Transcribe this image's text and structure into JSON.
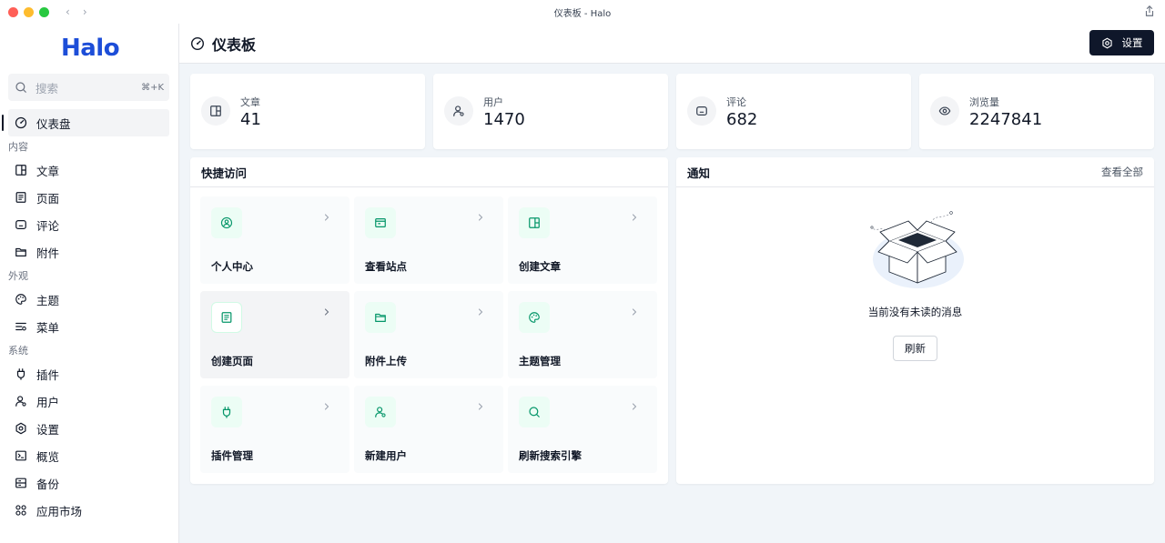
{
  "window": {
    "title": "仪表板 - Halo"
  },
  "app": {
    "logo": "Halo"
  },
  "search": {
    "placeholder": "搜索",
    "shortcut": "⌘+K"
  },
  "sidebar": {
    "dashboard": {
      "label": "仪表盘",
      "icon": "dashboard-icon"
    },
    "groups": [
      {
        "label": "内容",
        "items": [
          {
            "label": "文章",
            "icon": "post-icon"
          },
          {
            "label": "页面",
            "icon": "page-icon"
          },
          {
            "label": "评论",
            "icon": "comment-icon"
          },
          {
            "label": "附件",
            "icon": "folder-icon"
          }
        ]
      },
      {
        "label": "外观",
        "items": [
          {
            "label": "主题",
            "icon": "palette-icon"
          },
          {
            "label": "菜单",
            "icon": "menu-list-icon"
          }
        ]
      },
      {
        "label": "系统",
        "items": [
          {
            "label": "插件",
            "icon": "plug-icon"
          },
          {
            "label": "用户",
            "icon": "user-icon"
          },
          {
            "label": "设置",
            "icon": "gear-icon"
          },
          {
            "label": "概览",
            "icon": "terminal-icon"
          },
          {
            "label": "备份",
            "icon": "backup-icon"
          },
          {
            "label": "应用市场",
            "icon": "apps-icon"
          }
        ]
      }
    ]
  },
  "header": {
    "title": "仪表板",
    "settings_label": "设置"
  },
  "stats": [
    {
      "label": "文章",
      "value": "41",
      "icon": "post-icon"
    },
    {
      "label": "用户",
      "value": "1470",
      "icon": "user-icon"
    },
    {
      "label": "评论",
      "value": "682",
      "icon": "comment-icon"
    },
    {
      "label": "浏览量",
      "value": "2247841",
      "icon": "eye-icon"
    }
  ],
  "quick_access": {
    "title": "快捷访问",
    "items": [
      {
        "label": "个人中心",
        "icon": "user-circle-icon"
      },
      {
        "label": "查看站点",
        "icon": "browser-icon"
      },
      {
        "label": "创建文章",
        "icon": "post-icon"
      },
      {
        "label": "创建页面",
        "icon": "page-icon"
      },
      {
        "label": "附件上传",
        "icon": "folder-icon"
      },
      {
        "label": "主题管理",
        "icon": "palette-icon"
      },
      {
        "label": "插件管理",
        "icon": "plug-icon"
      },
      {
        "label": "新建用户",
        "icon": "user-add-icon"
      },
      {
        "label": "刷新搜索引擎",
        "icon": "search-icon"
      }
    ]
  },
  "notifications": {
    "title": "通知",
    "view_all": "查看全部",
    "empty_text": "当前没有未读的消息",
    "refresh_label": "刷新"
  },
  "colors": {
    "accent_green": "#059669",
    "dark_button": "#0f172a",
    "brand_blue": "#1d4ed8"
  }
}
